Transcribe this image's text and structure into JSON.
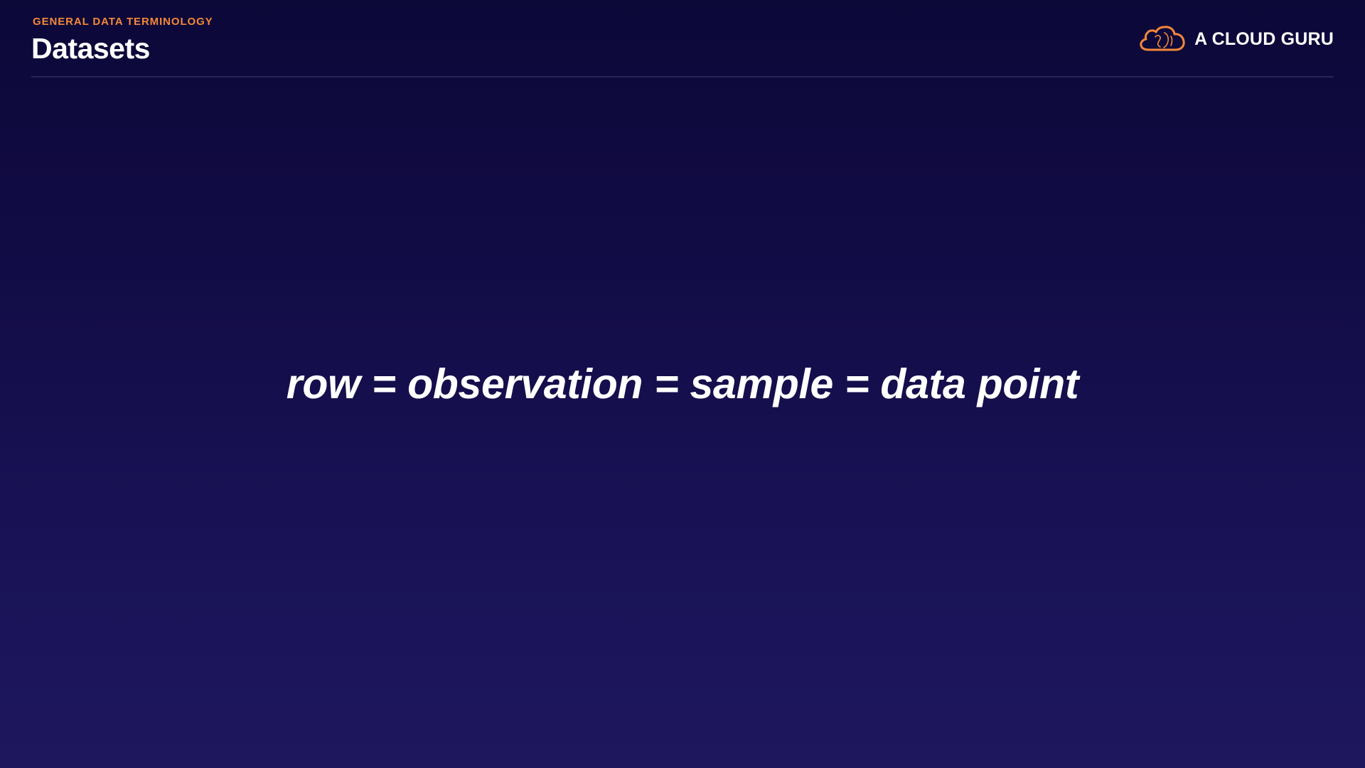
{
  "header": {
    "eyebrow": "GENERAL DATA TERMINOLOGY",
    "title": "Datasets"
  },
  "brand": {
    "name": "A CLOUD GURU",
    "icon": "cloud-logo-icon",
    "accent_color": "#f4883a"
  },
  "main": {
    "statement": "row = observation = sample = data point"
  }
}
